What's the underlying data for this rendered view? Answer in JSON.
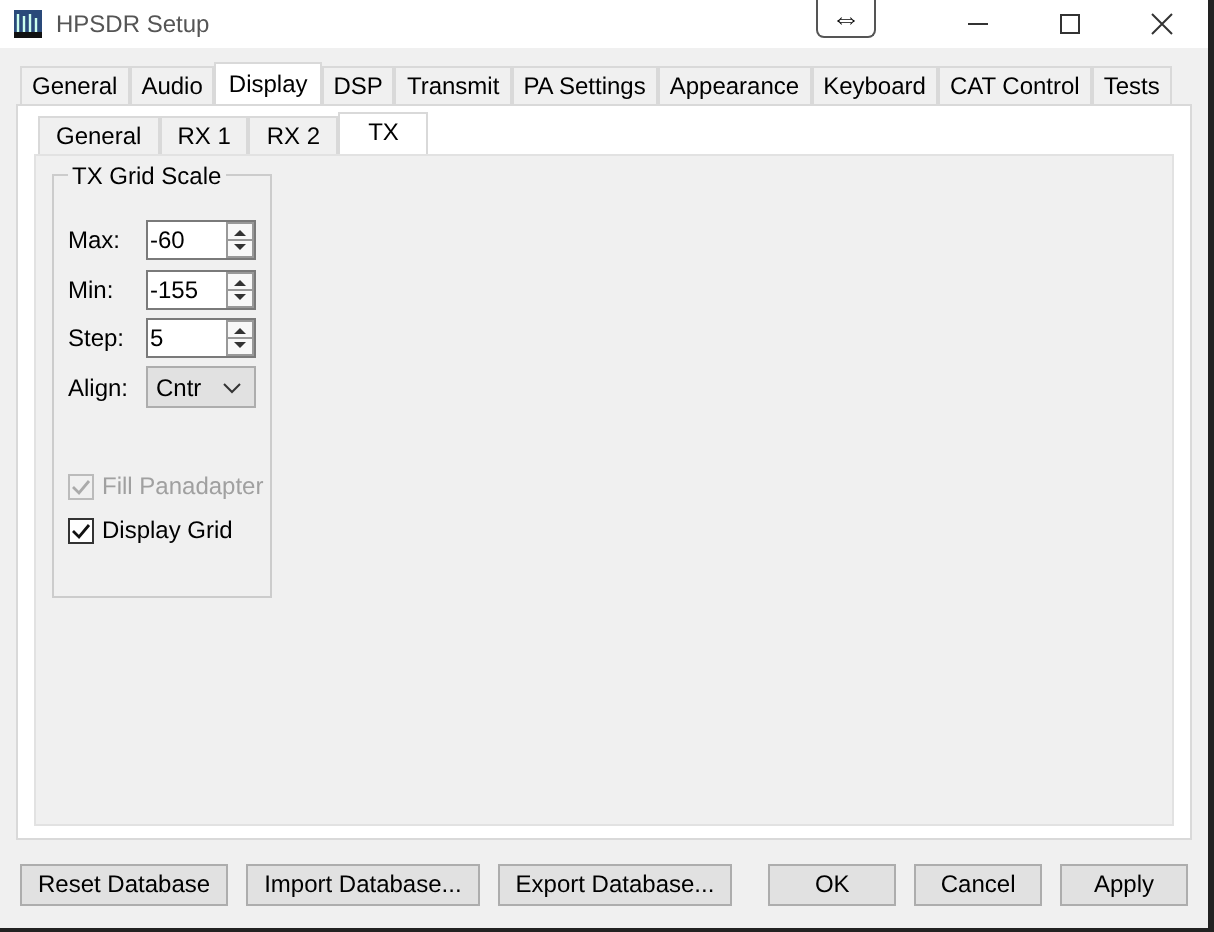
{
  "window": {
    "title": "HPSDR Setup",
    "overlay_glyph": "⇔"
  },
  "tabs": [
    {
      "label": "General",
      "selected": false
    },
    {
      "label": "Audio",
      "selected": false
    },
    {
      "label": "Display",
      "selected": true
    },
    {
      "label": "DSP",
      "selected": false
    },
    {
      "label": "Transmit",
      "selected": false
    },
    {
      "label": "PA Settings",
      "selected": false
    },
    {
      "label": "Appearance",
      "selected": false
    },
    {
      "label": "Keyboard",
      "selected": false
    },
    {
      "label": "CAT Control",
      "selected": false
    },
    {
      "label": "Tests",
      "selected": false
    }
  ],
  "subtabs": [
    {
      "label": "General",
      "selected": false
    },
    {
      "label": "RX 1",
      "selected": false
    },
    {
      "label": "RX 2",
      "selected": false
    },
    {
      "label": "TX",
      "selected": true
    }
  ],
  "group": {
    "title": "TX Grid Scale",
    "fields": [
      {
        "label": "Max:",
        "kind": "spin",
        "value": "-60"
      },
      {
        "label": "Min:",
        "kind": "spin",
        "value": "-155"
      },
      {
        "label": "Step:",
        "kind": "spin",
        "value": "5"
      },
      {
        "label": "Align:",
        "kind": "select",
        "value": "Cntr"
      }
    ],
    "checkboxes": [
      {
        "label": "Fill Panadapter",
        "checked": true,
        "disabled": true
      },
      {
        "label": "Display Grid",
        "checked": true,
        "disabled": false
      }
    ]
  },
  "buttons_left": [
    "Reset Database",
    "Import Database...",
    "Export Database..."
  ],
  "buttons_right": [
    "OK",
    "Cancel",
    "Apply"
  ]
}
